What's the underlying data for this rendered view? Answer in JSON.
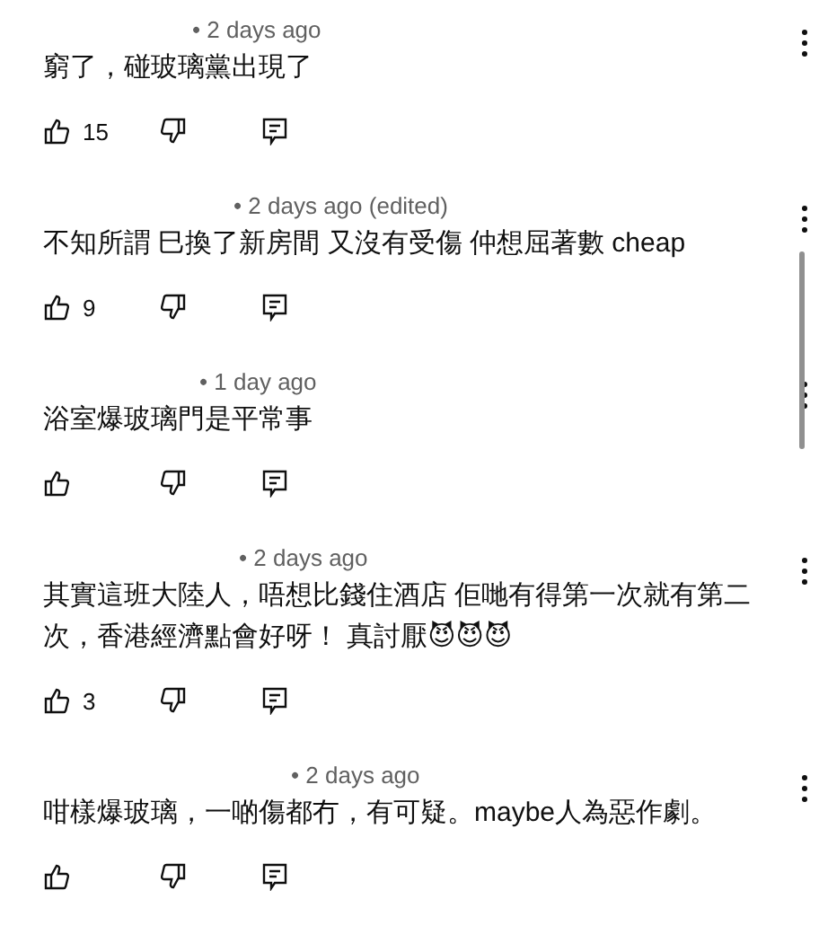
{
  "comments": [
    {
      "meta": "• 2 days ago",
      "text": "窮了，碰玻璃黨出現了",
      "likes": "15"
    },
    {
      "meta": "• 2 days ago (edited)",
      "text": "不知所謂  巳換了新房間  又沒有受傷 仲想屈著數  cheap",
      "likes": "9"
    },
    {
      "meta": "• 1 day ago",
      "text": "浴室爆玻璃門是平常事"
    },
    {
      "meta": "• 2 days ago",
      "text": "其實這班大陸人，唔想比錢住酒店 佢哋有得第一次就有第二次，香港經濟點會好呀！  真討厭😈😈😈",
      "likes": "3"
    },
    {
      "meta": "• 2 days ago",
      "text": "咁樣爆玻璃，一啲傷都冇，有可疑。maybe人為惡作劇。"
    }
  ]
}
